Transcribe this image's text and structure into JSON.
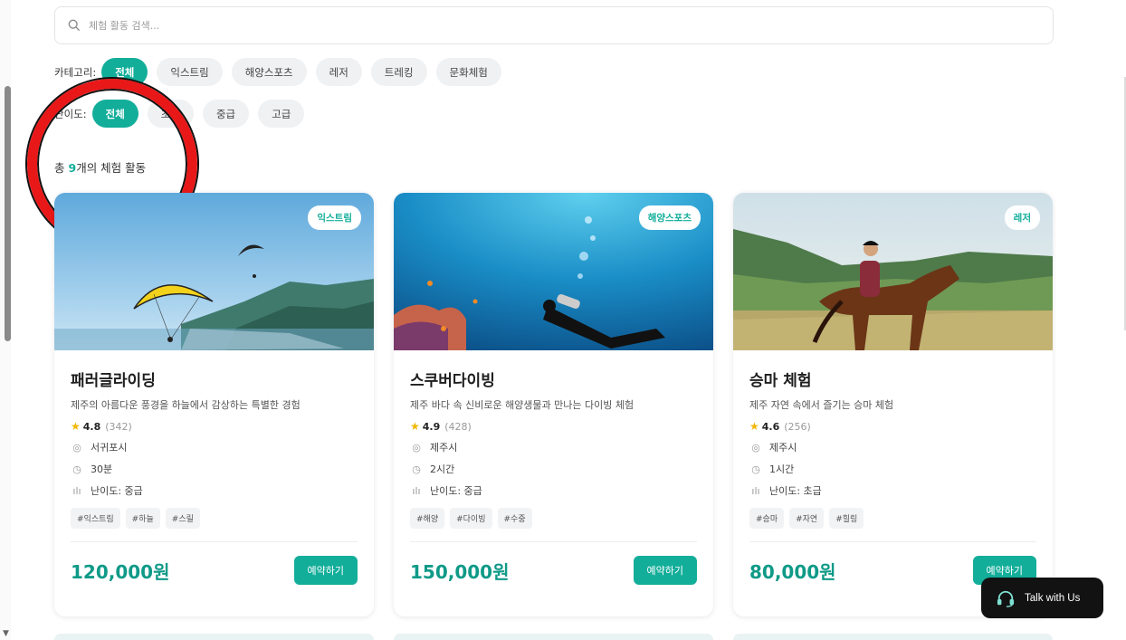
{
  "search": {
    "placeholder": "체험 활동 검색..."
  },
  "categories": {
    "label": "카테고리:",
    "items": [
      "전체",
      "익스트림",
      "해양스포츠",
      "레저",
      "트레킹",
      "문화체험"
    ]
  },
  "difficulty": {
    "label": "난이도:",
    "items": [
      "전체",
      "초급",
      "중급",
      "고급"
    ]
  },
  "summary": {
    "prefix": "총 ",
    "count": "9",
    "suffix": "개의 체험 활동"
  },
  "cards": [
    {
      "badge": "익스트림",
      "title": "패러글라이딩",
      "desc": "제주의 아름다운 풍경을 하늘에서 감상하는 특별한 경험",
      "rating": "4.8",
      "reviews": "(342)",
      "location": "서귀포시",
      "duration": "30분",
      "level": "난이도: 중급",
      "tags": [
        "#익스트림",
        "#하늘",
        "#스릴"
      ],
      "price": "120,000원",
      "book": "예약하기"
    },
    {
      "badge": "해양스포츠",
      "title": "스쿠버다이빙",
      "desc": "제주 바다 속 신비로운 해양생물과 만나는 다이빙 체험",
      "rating": "4.9",
      "reviews": "(428)",
      "location": "제주시",
      "duration": "2시간",
      "level": "난이도: 중급",
      "tags": [
        "#해양",
        "#다이빙",
        "#수중"
      ],
      "price": "150,000원",
      "book": "예약하기"
    },
    {
      "badge": "레저",
      "title": "승마 체험",
      "desc": "제주 자연 속에서 즐기는 승마 체험",
      "rating": "4.6",
      "reviews": "(256)",
      "location": "제주시",
      "duration": "1시간",
      "level": "난이도: 초급",
      "tags": [
        "#승마",
        "#자연",
        "#힐링"
      ],
      "price": "80,000원",
      "book": "예약하기"
    }
  ],
  "talk": {
    "label": "Talk with Us"
  },
  "colors": {
    "accent": "#13ae9a",
    "price": "#0f9a88",
    "star": "#f2b705",
    "annotation": "#e81818"
  },
  "icons": [
    "search-icon",
    "star-icon",
    "location-icon",
    "clock-icon",
    "chart-icon",
    "headset-icon"
  ]
}
